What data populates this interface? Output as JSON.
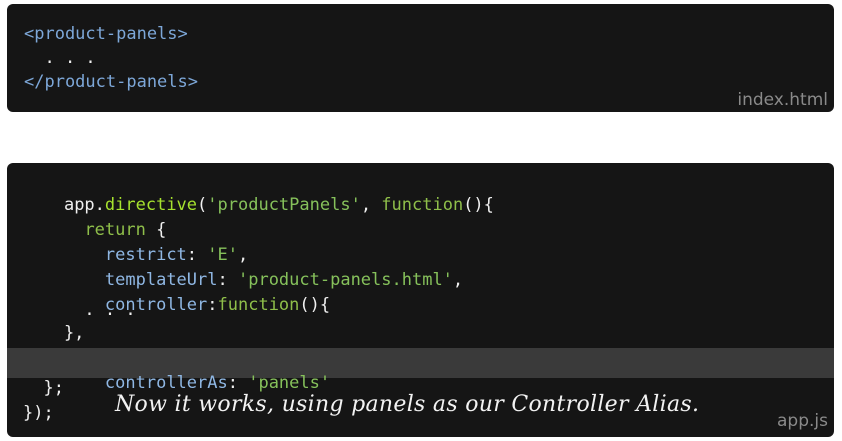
{
  "html_panel": {
    "lines": [
      "<product-panels>",
      "  . . .",
      "</product-panels>"
    ],
    "file_label": "index.html"
  },
  "js_panel": {
    "line1": {
      "a": "app.",
      "b": "directive",
      "c": "(",
      "d": "'productPanels'",
      "e": ", ",
      "f": "function",
      "g": "(){"
    },
    "line2": {
      "a": "  ",
      "b": "return",
      "c": " {"
    },
    "line3": {
      "a": "    ",
      "b": "restrict",
      "c": ": ",
      "d": "'E'",
      "e": ","
    },
    "line4": {
      "a": "    ",
      "b": "templateUrl",
      "c": ": ",
      "d": "'product-panels.html'",
      "e": ","
    },
    "line5": {
      "a": "    ",
      "b": "controller",
      "c": ":",
      "d": "function",
      "e": "(){"
    },
    "line6": "      . . .",
    "line7": "    },",
    "line8": {
      "a": "    ",
      "b": "controllerAs",
      "c": ": ",
      "d": "'panels'"
    },
    "line9": "  };",
    "line10": "});",
    "file_label": "app.js",
    "caption": "Now it works, using panels as our Controller Alias."
  }
}
